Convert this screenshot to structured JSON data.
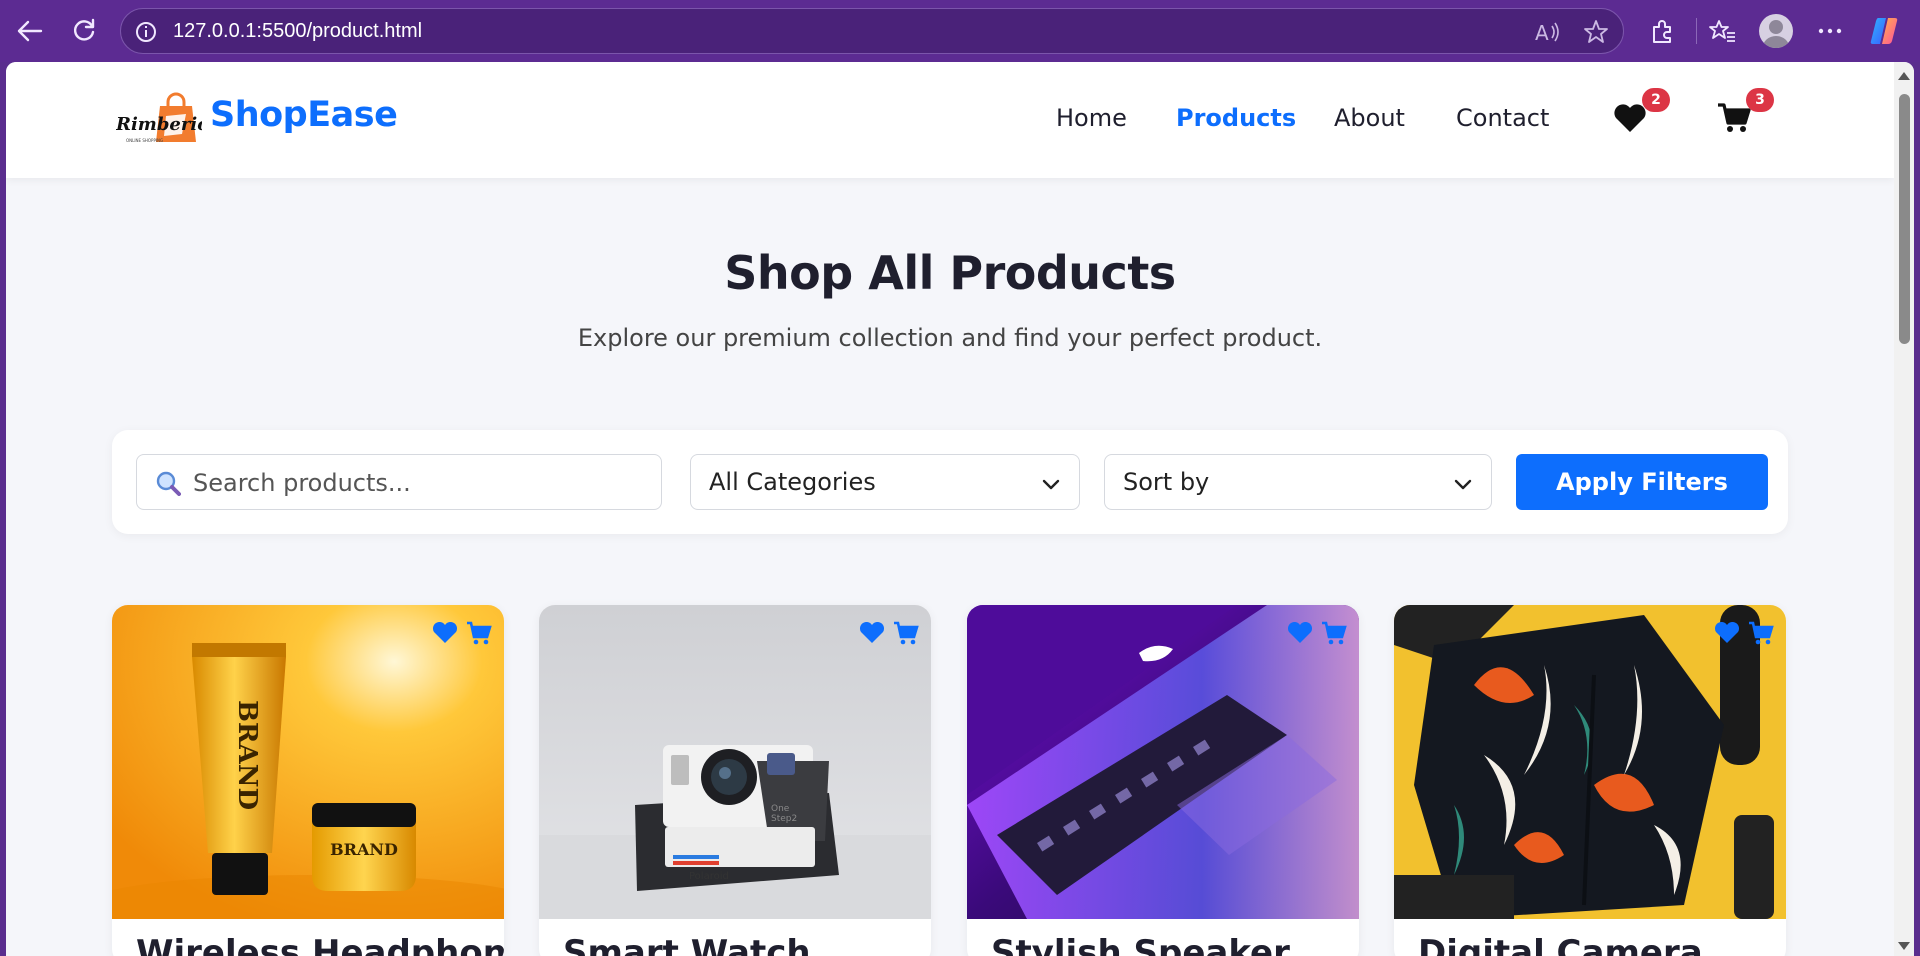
{
  "browser": {
    "url": "127.0.0.1:5500/product.html",
    "icons": [
      "back-arrow-icon",
      "refresh-icon",
      "info-icon",
      "read-aloud-icon",
      "favorite-star-icon",
      "extensions-icon",
      "favorites-icon",
      "profile-icon",
      "more-icon",
      "copilot-icon"
    ]
  },
  "header": {
    "logo_icon": "shopping-bag-logo",
    "logo_text": "Rimberio",
    "brand": "ShopEase",
    "nav": [
      {
        "label": "Home",
        "active": false
      },
      {
        "label": "Products",
        "active": true
      },
      {
        "label": "About",
        "active": false
      },
      {
        "label": "Contact",
        "active": false
      }
    ],
    "wishlist_count": "2",
    "cart_count": "3"
  },
  "hero": {
    "title": "Shop All Products",
    "subtitle": "Explore our premium collection and find your perfect product."
  },
  "filters": {
    "search_placeholder": "Search products...",
    "category_selected": "All Categories",
    "sort_selected": "Sort by",
    "apply_label": "Apply Filters"
  },
  "products": [
    {
      "name": "Wireless Headphones",
      "image": "skincare-tube-and-jar"
    },
    {
      "name": "Smart Watch",
      "image": "instant-camera"
    },
    {
      "name": "Stylish Speaker",
      "image": "laptop-purple-light"
    },
    {
      "name": "Digital Camera",
      "image": "tropical-shirt-flatlay"
    }
  ],
  "colors": {
    "primary": "#0d6efd",
    "badge": "#dc3545",
    "browser_frame": "#5c2b92",
    "page_bg": "#f5f6fa"
  }
}
